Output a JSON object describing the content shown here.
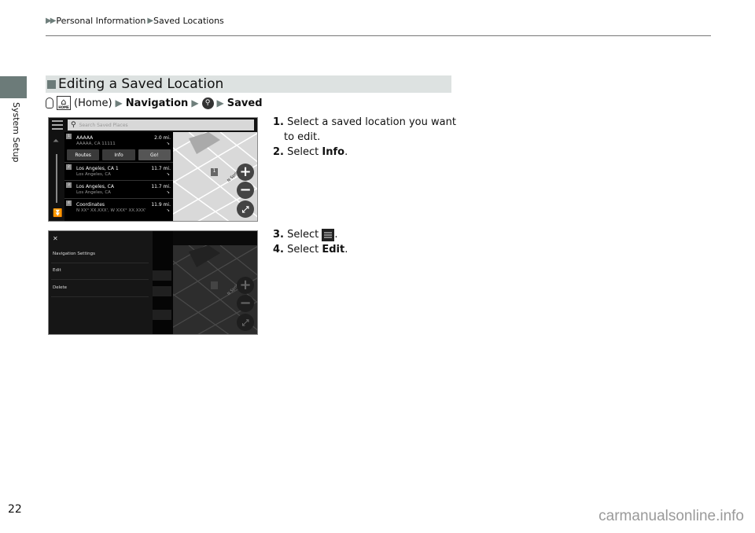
{
  "breadcrumb": {
    "items": [
      "Personal Information",
      "Saved Locations"
    ]
  },
  "sidebar": {
    "section_label": "System Setup"
  },
  "section": {
    "title": "Editing a Saved Location",
    "path": {
      "home_label": "(Home)",
      "navigation": "Navigation",
      "saved": "Saved",
      "home_icon_caption": "HOME"
    }
  },
  "screen1": {
    "search_placeholder": "Search Saved Places",
    "items": [
      {
        "num": "1",
        "name": "AAAAA",
        "addr": "AAAAA, CA 11111",
        "dist": "2.0 mi."
      },
      {
        "num": "2",
        "name": "Los Angeles, CA 1",
        "addr": "Los Angeles, CA",
        "dist": "11.7 mi."
      },
      {
        "num": "3",
        "name": "Los Angeles, CA",
        "addr": "Los Angeles, CA",
        "dist": "11.7 mi."
      },
      {
        "num": "4",
        "name": "Coordinates",
        "addr": "N XX° XX.XXX', W XXX° XX.XXX'",
        "dist": "11.9 mi."
      }
    ],
    "actions": {
      "routes": "Routes",
      "info": "Info",
      "go": "Go!"
    },
    "map": {
      "pin_label": "1",
      "street": "N Spring St"
    }
  },
  "screen2": {
    "menu": {
      "close": "✕",
      "items": [
        "Navigation Settings",
        "Edit",
        "Delete"
      ]
    },
    "map": {
      "street": "N Spring St"
    }
  },
  "steps": [
    {
      "num": "1.",
      "text_a": "Select a saved location you want",
      "text_b": "to edit."
    },
    {
      "num": "2.",
      "text": "Select ",
      "ui": "Info",
      "end": "."
    },
    {
      "num": "3.",
      "text": "Select ",
      "end": "."
    },
    {
      "num": "4.",
      "text": "Select ",
      "ui": "Edit",
      "end": "."
    }
  ],
  "footer": {
    "page_number": "22",
    "watermark": "carmanualsonline.info"
  }
}
